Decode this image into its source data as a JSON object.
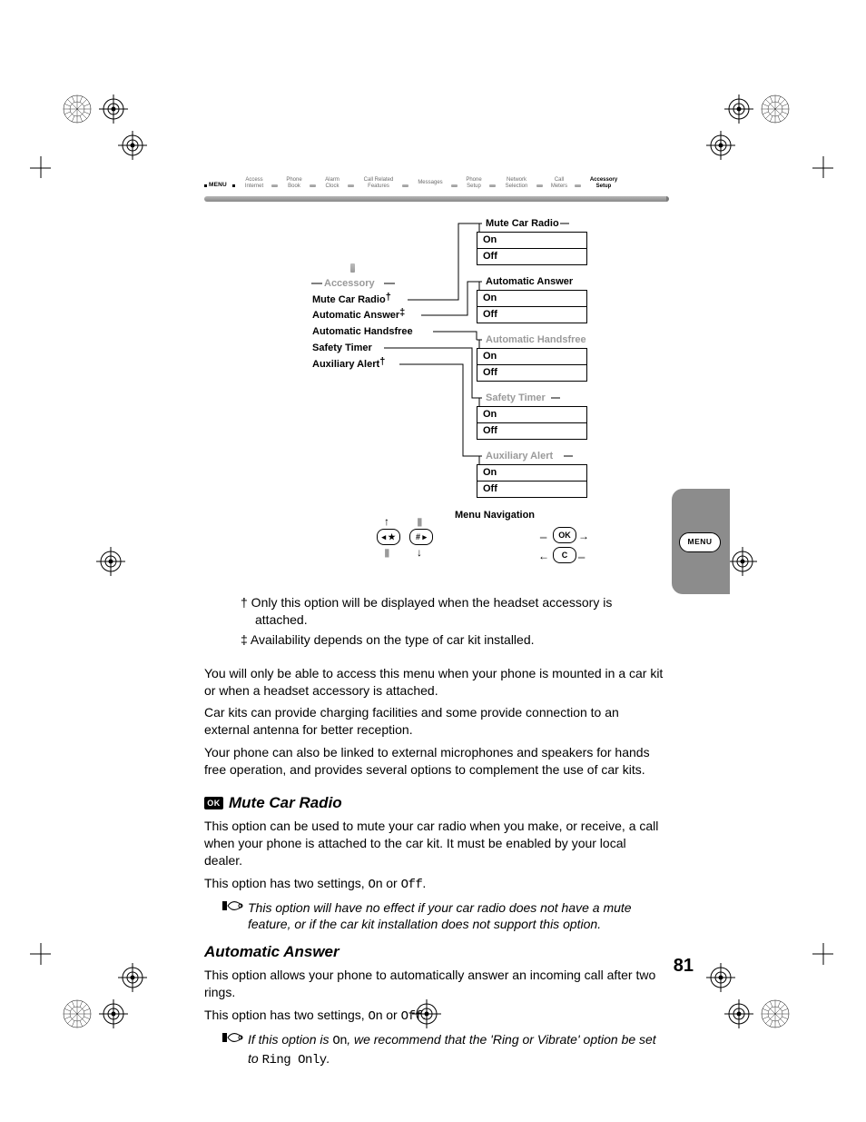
{
  "breadcrumb": {
    "menu_label": "MENU",
    "items": [
      {
        "line1": "Access",
        "line2": "Internet"
      },
      {
        "line1": "Phone",
        "line2": "Book"
      },
      {
        "line1": "Alarm",
        "line2": "Clock"
      },
      {
        "line1": "Call Related",
        "line2": "Features"
      },
      {
        "line1": "Messages",
        "line2": ""
      },
      {
        "line1": "Phone",
        "line2": "Setup"
      },
      {
        "line1": "Network",
        "line2": "Selection"
      },
      {
        "line1": "Call",
        "line2": "Meters"
      },
      {
        "line1": "Accessory",
        "line2": "Setup",
        "active": true
      }
    ]
  },
  "tree": {
    "root": "Accessory",
    "items": [
      {
        "label": "Mute Car Radio",
        "mark": "†"
      },
      {
        "label": "Automatic Answer",
        "mark": "‡"
      },
      {
        "label": "Automatic Handsfree",
        "mark": ""
      },
      {
        "label": "Safety Timer",
        "mark": ""
      },
      {
        "label": "Auxiliary Alert",
        "mark": "†"
      }
    ],
    "submenus": [
      {
        "title": "Mute Car Radio",
        "opts": [
          "On",
          "Off"
        ]
      },
      {
        "title": "Automatic Answer",
        "opts": [
          "On",
          "Off"
        ]
      },
      {
        "title": "Automatic Handsfree",
        "opts": [
          "On",
          "Off"
        ],
        "ghost": true
      },
      {
        "title": "Safety Timer",
        "opts": [
          "On",
          "Off"
        ],
        "ghost": true
      },
      {
        "title": "Auxiliary Alert",
        "opts": [
          "On",
          "Off"
        ],
        "ghost": true
      }
    ],
    "nav_title": "Menu Navigation",
    "ok_label": "OK",
    "c_label": "C"
  },
  "footnotes": {
    "f1": "†  Only this option will be displayed when the headset accessory is attached.",
    "f2": "‡  Availability depends on the type of car kit installed."
  },
  "paras": {
    "p1": "You will only be able to access this menu when your phone is mounted in a car kit or when a headset accessory is attached.",
    "p2": "Car kits can provide charging facilities and some provide connection to an external antenna for better reception.",
    "p3": "Your phone can also be linked to external microphones and speakers for hands free operation, and provides several options to complement the use of car kits."
  },
  "sections": {
    "mute": {
      "title": "Mute Car Radio",
      "p1": "This option can be used to mute your car radio when you make, or receive, a call when your phone is attached to the car kit. It must be enabled by your local dealer.",
      "p2_pre": "This option has two settings, ",
      "p2_on": "On",
      "p2_mid": " or ",
      "p2_off": "Off",
      "p2_post": ".",
      "note": "This option will have no effect if your car radio does not have a mute feature, or if the car kit installation does not support this option."
    },
    "auto": {
      "title": "Automatic Answer",
      "p1": "This option allows your phone to automatically answer an incoming call after two rings.",
      "p2_pre": "This option has two settings, ",
      "p2_on": "On",
      "p2_mid": " or ",
      "p2_off": "Off",
      "p2_post": ".",
      "note_pre": "If this option is ",
      "note_on": "On",
      "note_mid": ", we recommend that the 'Ring or Vibrate' option be set to ",
      "note_ring": "Ring Only",
      "note_post": "."
    }
  },
  "side_tab": "MENU",
  "page_number": "81",
  "ok_badge": "OK"
}
